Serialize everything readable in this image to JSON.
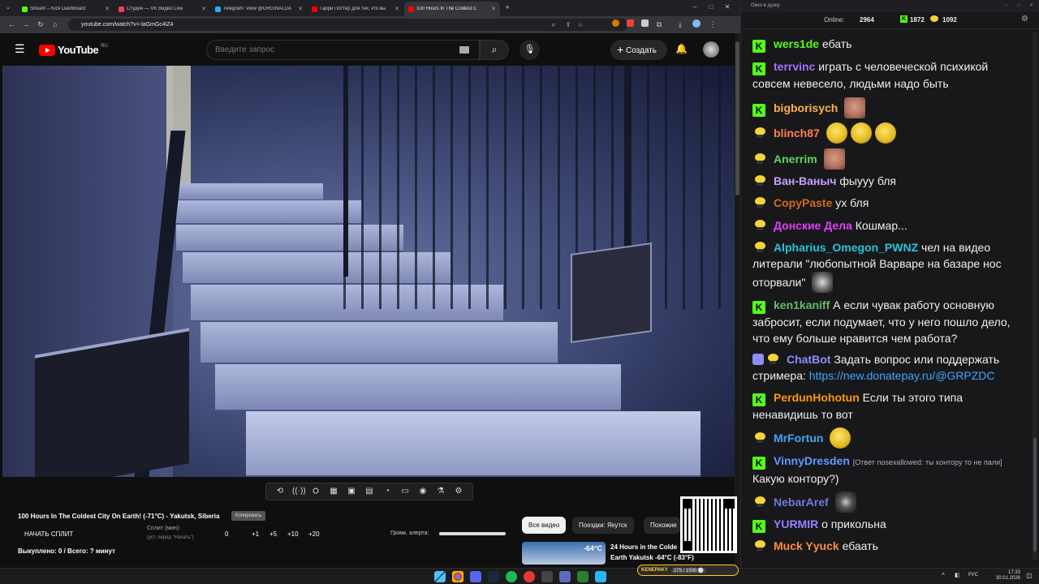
{
  "browser": {
    "tabs": [
      {
        "title": "Stream – Kick Dashboard",
        "color": "#53fc18",
        "active": false
      },
      {
        "title": "Студия — VK Видео Live",
        "color": "#ff3b5c",
        "active": false
      },
      {
        "title": "Telegram: View @ORGINALDA",
        "color": "#2aabee",
        "active": false
      },
      {
        "title": "Гарри Поттер для тех, кто вы",
        "color": "#ff0000",
        "active": false
      },
      {
        "title": "100 Hours In The Coldest C",
        "color": "#ff0000",
        "active": true
      }
    ],
    "new_tab_label": "+",
    "url": "youtube.com/watch?v=-laGmGc4iZ4"
  },
  "youtube": {
    "logo": "YouTube",
    "region": "RU",
    "search_placeholder": "Введите запрос",
    "create_label": "Создать",
    "video_title": "100 Hours In The Coldest City On Earth! (-71°C) - Yakutsk, Siberia",
    "copy_button": "Копировать",
    "chips": [
      "Все видео",
      "Поездки: Якутск",
      "Похожие"
    ],
    "recommended": {
      "title_line1": "24 Hours in the Colde",
      "title_line2": "Earth Yakutsk -64°C (-83°F)",
      "thumb_label": "-64°C"
    }
  },
  "stream_panel": {
    "start_split": "НАЧАТЬ СПЛИТ",
    "split_label": "Сплит (мин):",
    "split_hint": "(уст. перед \"Начать\")",
    "split_value": "0",
    "plus_buttons": [
      "+1",
      "+5",
      "+10",
      "+20"
    ],
    "volume_label": "Громк. алерта:",
    "volume_level": 1.0,
    "bought": "Выкуплено: 0 / Всего: ? минут",
    "widget_label": "KENEPAKY",
    "widget_progress": "275 / 1500 ⚪"
  },
  "chat": {
    "window_title": "Окно в дуэку",
    "online_label": "Online:",
    "online_count": "2964",
    "kick_count": "1872",
    "emote_count": "1092",
    "messages": [
      {
        "badge": "kick",
        "nick": "wers1de",
        "color": "#53fc18",
        "text": "ебать"
      },
      {
        "badge": "kick",
        "nick": "terrvinc",
        "color": "#a970ff",
        "text": "играть с человеческой психикой совсем невесело, людьми надо быть"
      },
      {
        "badge": "kick",
        "nick": "bigborisych",
        "color": "#ffb347",
        "text": ""
      },
      {
        "badge": "emote",
        "nick": "blinch87",
        "color": "#ff7f50",
        "text": ""
      },
      {
        "badge": "emote",
        "nick": "Anerrim",
        "color": "#5fd35f",
        "text": ""
      },
      {
        "badge": "emote",
        "nick": "Ван-Ваныч",
        "color": "#c9a0ff",
        "text": "фыууу бля"
      },
      {
        "badge": "emote",
        "nick": "CopyPaste",
        "color": "#d2691e",
        "text": "ух бля"
      },
      {
        "badge": "emote",
        "nick": "Донские Дела",
        "color": "#e040fb",
        "text": "Кошмар..."
      },
      {
        "badge": "emote",
        "nick": "Alpharius_Omegon_PWNZ",
        "color": "#26c6da",
        "text": "чел на видео литерали \"любопытной Варваре на базаре нос оторвали\""
      },
      {
        "badge": "kick",
        "nick": "ken1kaniff",
        "color": "#66bb6a",
        "text": "А если чувак работу основную забросит, если подумает, что у него пошло дело, что ему больше нравится чем работа?"
      },
      {
        "badge": "bot",
        "nick": "ChatBot",
        "color": "#8e8cff",
        "text": "Задать вопрос или поддержать стримера:",
        "link": "https://new.donatepay.ru/@GRPZDC"
      },
      {
        "badge": "kick",
        "nick": "PerdunHohotun",
        "color": "#ff9800",
        "text": "Если ты этого типа ненавидишь то вот"
      },
      {
        "badge": "emote",
        "nick": "MrFortun",
        "color": "#42a5f5",
        "text": ""
      },
      {
        "badge": "kick",
        "nick": "VinnyDresden",
        "color": "#5c9bff",
        "reply": "[Ответ nosexallowed: ты контору то не пали]",
        "text": "Какую контору?)"
      },
      {
        "badge": "emote",
        "nick": "NebarAref",
        "color": "#6d7bd6",
        "text": ""
      },
      {
        "badge": "kick",
        "nick": "YURMIR",
        "color": "#9b7dff",
        "text": "о прикольна"
      },
      {
        "badge": "emote",
        "nick": "Muck Yyuck",
        "color": "#ff8a3d",
        "text": "ебаать"
      }
    ]
  },
  "taskbar": {
    "lang": "РУС",
    "time": "17:33",
    "date": "30.01.2026"
  }
}
